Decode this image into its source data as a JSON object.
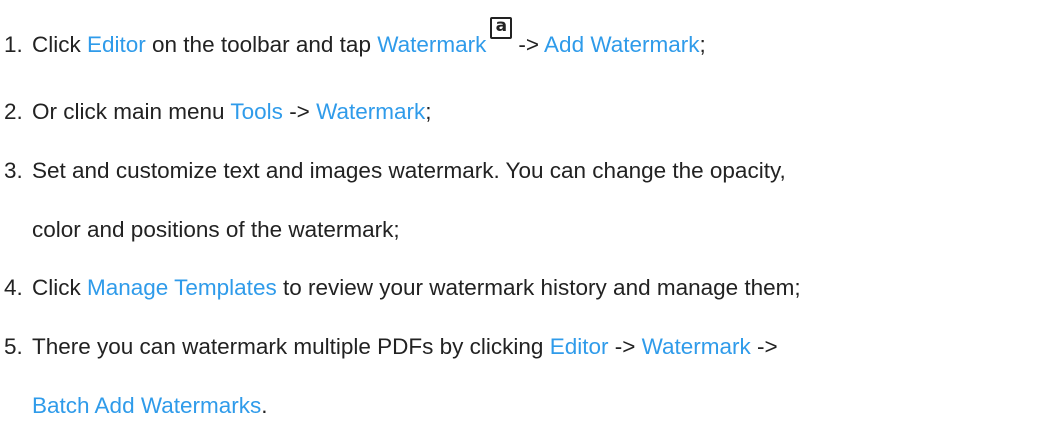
{
  "steps": [
    {
      "number": "1.",
      "parts": [
        {
          "type": "text",
          "text": "Click "
        },
        {
          "type": "link",
          "text": "Editor"
        },
        {
          "type": "text",
          "text": " on the toolbar and tap "
        },
        {
          "type": "link",
          "text": "Watermark"
        },
        {
          "type": "icon",
          "icon": "watermark-icon",
          "glyph": "a"
        },
        {
          "type": "text",
          "text": "-> "
        },
        {
          "type": "link",
          "text": "Add Watermark"
        },
        {
          "type": "text",
          "text": ";"
        }
      ]
    },
    {
      "number": "2.",
      "parts": [
        {
          "type": "text",
          "text": "Or click main menu "
        },
        {
          "type": "link",
          "text": "Tools"
        },
        {
          "type": "text",
          "text": " -> "
        },
        {
          "type": "link",
          "text": "Watermark"
        },
        {
          "type": "text",
          "text": ";"
        }
      ]
    },
    {
      "number": "3.",
      "parts": [
        {
          "type": "text",
          "text": "Set and customize text and images watermark. You can change the opacity,"
        }
      ],
      "continuation": [
        {
          "type": "text",
          "text": "color and positions of the watermark;"
        }
      ]
    },
    {
      "number": "4.",
      "parts": [
        {
          "type": "text",
          "text": "Click "
        },
        {
          "type": "link",
          "text": "Manage Templates"
        },
        {
          "type": "text",
          "text": " to review your watermark history and manage them;"
        }
      ]
    },
    {
      "number": "5.",
      "parts": [
        {
          "type": "text",
          "text": "There you can watermark multiple PDFs by clicking "
        },
        {
          "type": "link",
          "text": "Editor"
        },
        {
          "type": "text",
          "text": " -> "
        },
        {
          "type": "link",
          "text": "Watermark"
        },
        {
          "type": "text",
          "text": " ->"
        }
      ],
      "continuation": [
        {
          "type": "link",
          "text": "Batch Add Watermarks"
        },
        {
          "type": "text",
          "text": "."
        }
      ]
    }
  ],
  "colors": {
    "text": "#222222",
    "link": "#2f9bea",
    "background": "#ffffff"
  }
}
